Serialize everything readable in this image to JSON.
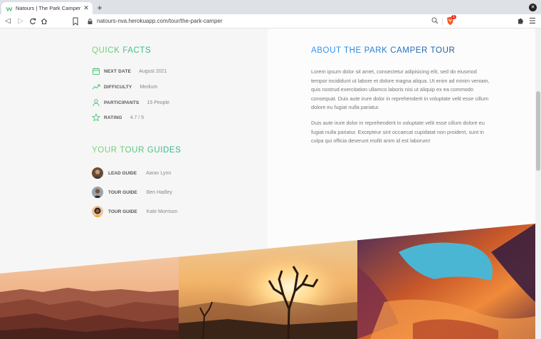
{
  "browser": {
    "tab_title": "Natours | The Park Camper Tour",
    "tab_close": "✕",
    "new_tab": "+",
    "url": "natours-nva.herokuapp.com/tour/the-park-camper",
    "shield_badge": "1"
  },
  "quick_facts": {
    "title": "Quick facts",
    "items": [
      {
        "icon": "calendar-icon",
        "label": "Next date",
        "value": "August 2021"
      },
      {
        "icon": "trending-up-icon",
        "label": "Difficulty",
        "value": "Medium"
      },
      {
        "icon": "user-icon",
        "label": "Participants",
        "value": "15 People"
      },
      {
        "icon": "star-icon",
        "label": "Rating",
        "value": "4.7 / 5"
      }
    ]
  },
  "guides": {
    "title": "Your tour guides",
    "items": [
      {
        "role": "Lead guide",
        "name": "Aarav Lynn"
      },
      {
        "role": "Tour guide",
        "name": "Ben Hadley"
      },
      {
        "role": "Tour guide",
        "name": "Kate Morrison"
      }
    ]
  },
  "about": {
    "title": "About the park camper tour",
    "paragraphs": [
      "Lorem ipsum dolor sit amet, consectetur adipisicing elit, sed do eiusmod tempor incididunt ut labore et dolore magna aliqua. Ut enim ad minim veniam, quis nostrud exercitation ullamco laboris nisi ut aliquip ex ea commodo consequat. Duis aute irure dolor in reprehenderit in voluptate velit esse cillum dolore eu fugiat nulla pariatur.",
      "Duis aute irure dolor in reprehenderit in voluptate velit esse cillum dolore eu fugiat nulla pariatur. Excepteur sint occaecat cupidatat non proident, sunt in culpa qui officia deserunt mollit anim id est laborum!"
    ]
  },
  "colors": {
    "accent_green": "#55c57a",
    "accent_blue": "#2998ff",
    "text_gray": "#777777"
  }
}
